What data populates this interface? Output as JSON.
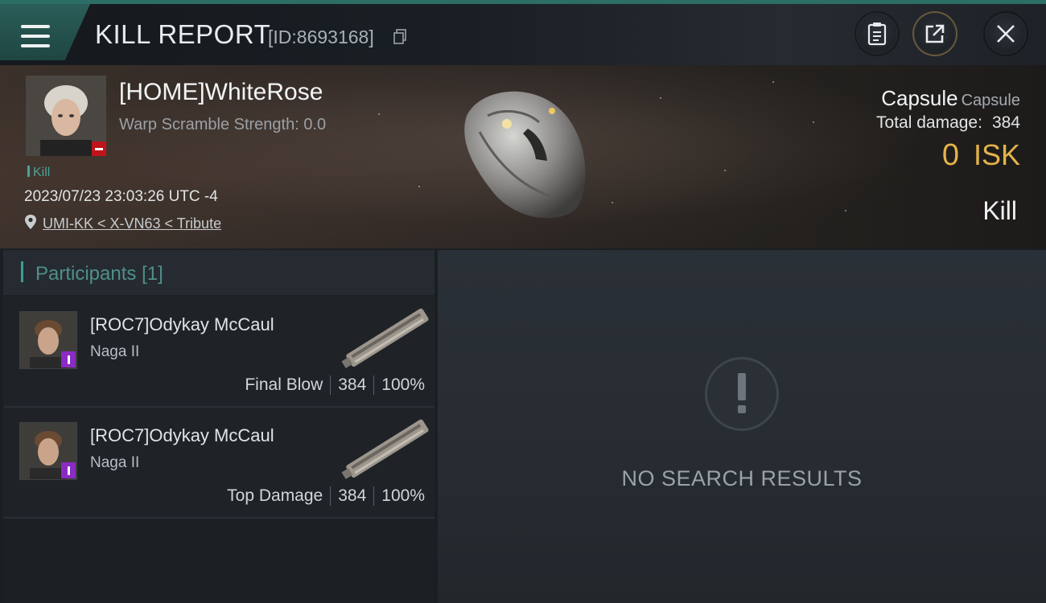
{
  "header": {
    "title": "KILL REPORT",
    "report_id": "[ID:8693168]",
    "icons": [
      "menu-icon",
      "copy-icon",
      "clipboard-icon",
      "share-icon",
      "close-icon"
    ]
  },
  "victim": {
    "name": "[HOME]WhiteRose",
    "warp_scramble": "Warp Scramble Strength: 0.0",
    "kill_tag": "Kill",
    "timestamp": "2023/07/23 23:03:26 UTC -4",
    "location": "UMI-KK < X-VN63 < Tribute",
    "ship_name": "Capsule",
    "ship_class": "Capsule",
    "total_damage_label": "Total damage:",
    "total_damage_value": "384",
    "isk_value": "0",
    "isk_unit": "ISK",
    "result": "Kill"
  },
  "participants": {
    "title": "Participants",
    "count": "[1]",
    "rows": [
      {
        "name": "[ROC7]Odykay McCaul",
        "ship": "Naga II",
        "role": "Final Blow",
        "damage": "384",
        "percent": "100%"
      },
      {
        "name": "[ROC7]Odykay McCaul",
        "ship": "Naga II",
        "role": "Top Damage",
        "damage": "384",
        "percent": "100%"
      }
    ]
  },
  "detail": {
    "empty_text": "NO SEARCH RESULTS"
  },
  "colors": {
    "accent": "#3a9d94",
    "isk": "#e3b34a",
    "badge_red": "#c0141a",
    "badge_purple": "#8a2bc4"
  }
}
